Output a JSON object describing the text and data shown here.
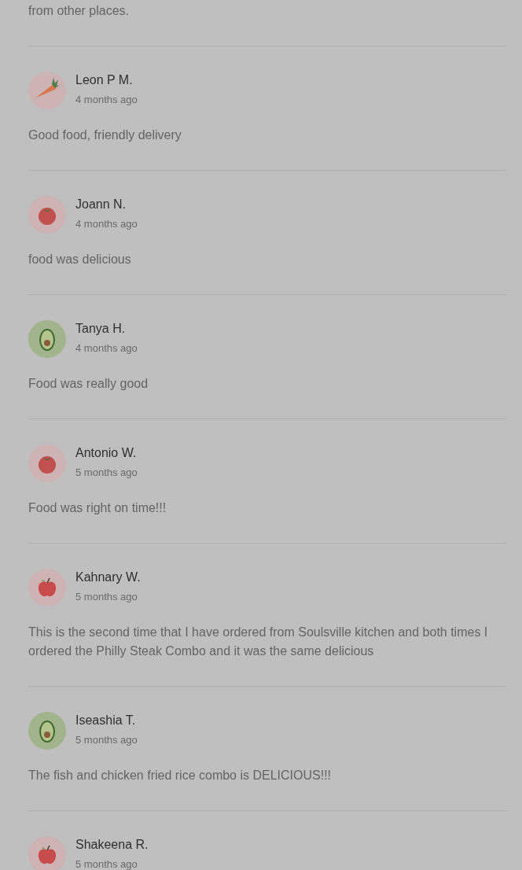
{
  "previous_review_tail": "from other places.",
  "reviews": [
    {
      "name": "Leon P M.",
      "time": "4 months ago",
      "text": "Good food, friendly delivery",
      "kind": "carrot"
    },
    {
      "name": "Joann N.",
      "time": "4 months ago",
      "text": "food was delicious",
      "kind": "tomato"
    },
    {
      "name": "Tanya H.",
      "time": "4 months ago",
      "text": "Food was really good",
      "kind": "avocado"
    },
    {
      "name": "Antonio W.",
      "time": "5 months ago",
      "text": "Food was right on time!!!",
      "kind": "tomato"
    },
    {
      "name": "Kahnary W.",
      "time": "5 months ago",
      "text": "This is the second time that I have ordered from Soulsville kitchen and both times I ordered the Philly Steak Combo and it was the same delicious",
      "kind": "apple"
    },
    {
      "name": "Iseashia T.",
      "time": "5 months ago",
      "text": "The fish and chicken fried rice combo is DELICIOUS!!!",
      "kind": "avocado"
    },
    {
      "name": "Shakeena R.",
      "time": "5 months ago",
      "kind": "apple"
    }
  ]
}
